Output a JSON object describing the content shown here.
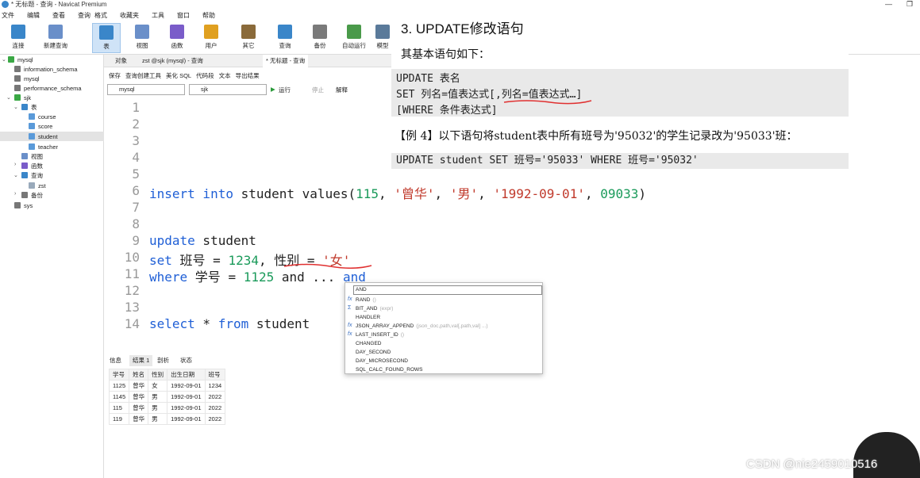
{
  "window": {
    "title": "* 无标题 - 查询 - Navicat Premium",
    "controls": [
      "—",
      "❐"
    ]
  },
  "menu": [
    "文件",
    "编辑",
    "查看",
    "查询",
    "格式",
    "收藏夹",
    "工具",
    "窗口",
    "帮助"
  ],
  "toolbar": [
    {
      "label": "连接",
      "color": "#3a86c9"
    },
    {
      "label": "新建查询",
      "color": "#6a8fc9"
    },
    {
      "label": "表",
      "color": "#3a86c9"
    },
    {
      "label": "视图",
      "color": "#6a8fc9"
    },
    {
      "label": "函数",
      "color": "#7a5cc9"
    },
    {
      "label": "用户",
      "color": "#e0a020"
    },
    {
      "label": "其它",
      "color": "#8a6a3a"
    },
    {
      "label": "查询",
      "color": "#3a86c9"
    },
    {
      "label": "备份",
      "color": "#7a7a7a"
    },
    {
      "label": "自动运行",
      "color": "#4a9a4a"
    },
    {
      "label": "模型",
      "color": "#5a7a9a"
    }
  ],
  "sidebar": {
    "nodes": [
      "mysql",
      "information_schema",
      "mysql",
      "performance_schema",
      "sjk",
      "表",
      "course",
      "score",
      "student",
      "teacher",
      "视图",
      "函数",
      "查询",
      "zst",
      "备份",
      "sys"
    ]
  },
  "tabs": [
    "对象",
    "zst @sjk (mysql) - 查询",
    "* 无标题 - 查询"
  ],
  "editor_toolbar": [
    "保存",
    "查询创建工具",
    "美化 SQL",
    "代码段",
    "文本",
    "导出结果"
  ],
  "editor_toolbar2": {
    "conn": "mysql",
    "db": "sjk",
    "run": "运行",
    "stop": "停止",
    "explain": "解释"
  },
  "code": {
    "line_numbers": [
      "1",
      "2",
      "3",
      "4",
      "5",
      "6",
      "7",
      "8",
      "9",
      "10",
      "11",
      "12",
      "13",
      "14"
    ],
    "l6": [
      "insert into",
      " student values(",
      "115",
      ", ",
      "'曾华'",
      ", ",
      "'男'",
      ", ",
      "'1992-09-01'",
      ", ",
      "09033",
      ")"
    ],
    "l9": [
      "update",
      " student"
    ],
    "l10": [
      "set",
      " 班号 = ",
      "1234",
      ", 性别 = ",
      "'女'"
    ],
    "l11": [
      "where",
      " 学号 = ",
      "1125",
      " and ... ",
      "and"
    ],
    "l14": [
      "select",
      " * ",
      "from",
      " student"
    ]
  },
  "overlay": {
    "heading": "3. UPDATE修改语句",
    "intro": "其基本语句如下：",
    "syntax": [
      "UPDATE  表名",
      "SET 列名=值表达式[,列名=值表达式…]",
      "[WHERE 条件表达式]"
    ],
    "example": "【例 4】以下语句将student表中所有班号为'95032'的学生记录改为'95033'班：",
    "example_code": "UPDATE student SET 班号='95033' WHERE 班号='95032'"
  },
  "autocomplete": {
    "input": "AND",
    "items": [
      {
        "name": "RAND",
        "hint": "()"
      },
      {
        "name": "BIT_AND",
        "hint": "(expr)"
      },
      {
        "name": "HANDLER",
        "hint": ""
      },
      {
        "name": "JSON_ARRAY_APPEND",
        "hint": "(json_doc,path,val[,path,val] ...)"
      },
      {
        "name": "LAST_INSERT_ID",
        "hint": "()"
      },
      {
        "name": "CHANGED",
        "hint": ""
      },
      {
        "name": "DAY_SECOND",
        "hint": ""
      },
      {
        "name": "DAY_MICROSECOND",
        "hint": ""
      },
      {
        "name": "SQL_CALC_FOUND_ROWS",
        "hint": ""
      }
    ]
  },
  "results": {
    "tabs": [
      "信息",
      "结果 1",
      "剖析",
      "状态"
    ],
    "columns": [
      "学号",
      "姓名",
      "性别",
      "出生日期",
      "班号"
    ],
    "rows": [
      [
        "1125",
        "曾华",
        "女",
        "1992-09-01",
        "1234"
      ],
      [
        "1145",
        "曾华",
        "男",
        "1992-09-01",
        "2022"
      ],
      [
        "115",
        "曾华",
        "男",
        "1992-09-01",
        "2022"
      ],
      [
        "119",
        "曾华",
        "男",
        "1992-09-01",
        "2022"
      ]
    ]
  },
  "watermark": "CSDN @nie2459010516"
}
